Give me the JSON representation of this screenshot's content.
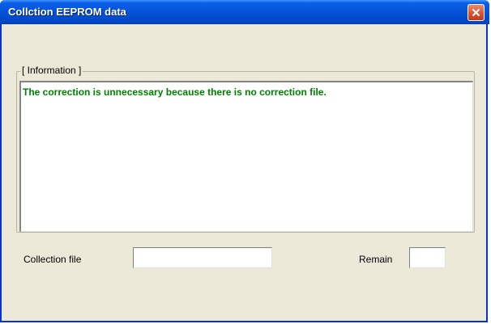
{
  "window": {
    "title": "Collction EEPROM data",
    "close_icon": "close-icon",
    "accent_color": "#0553d9",
    "close_color": "#d8502c"
  },
  "information": {
    "legend": "[ Information ]",
    "message": "The correction is unnecessary because there is no correction file.",
    "message_color": "#008000"
  },
  "fields": {
    "collection_file_label": "Collection file",
    "collection_file_value": "",
    "remain_label": "Remain",
    "remain_value": ""
  }
}
